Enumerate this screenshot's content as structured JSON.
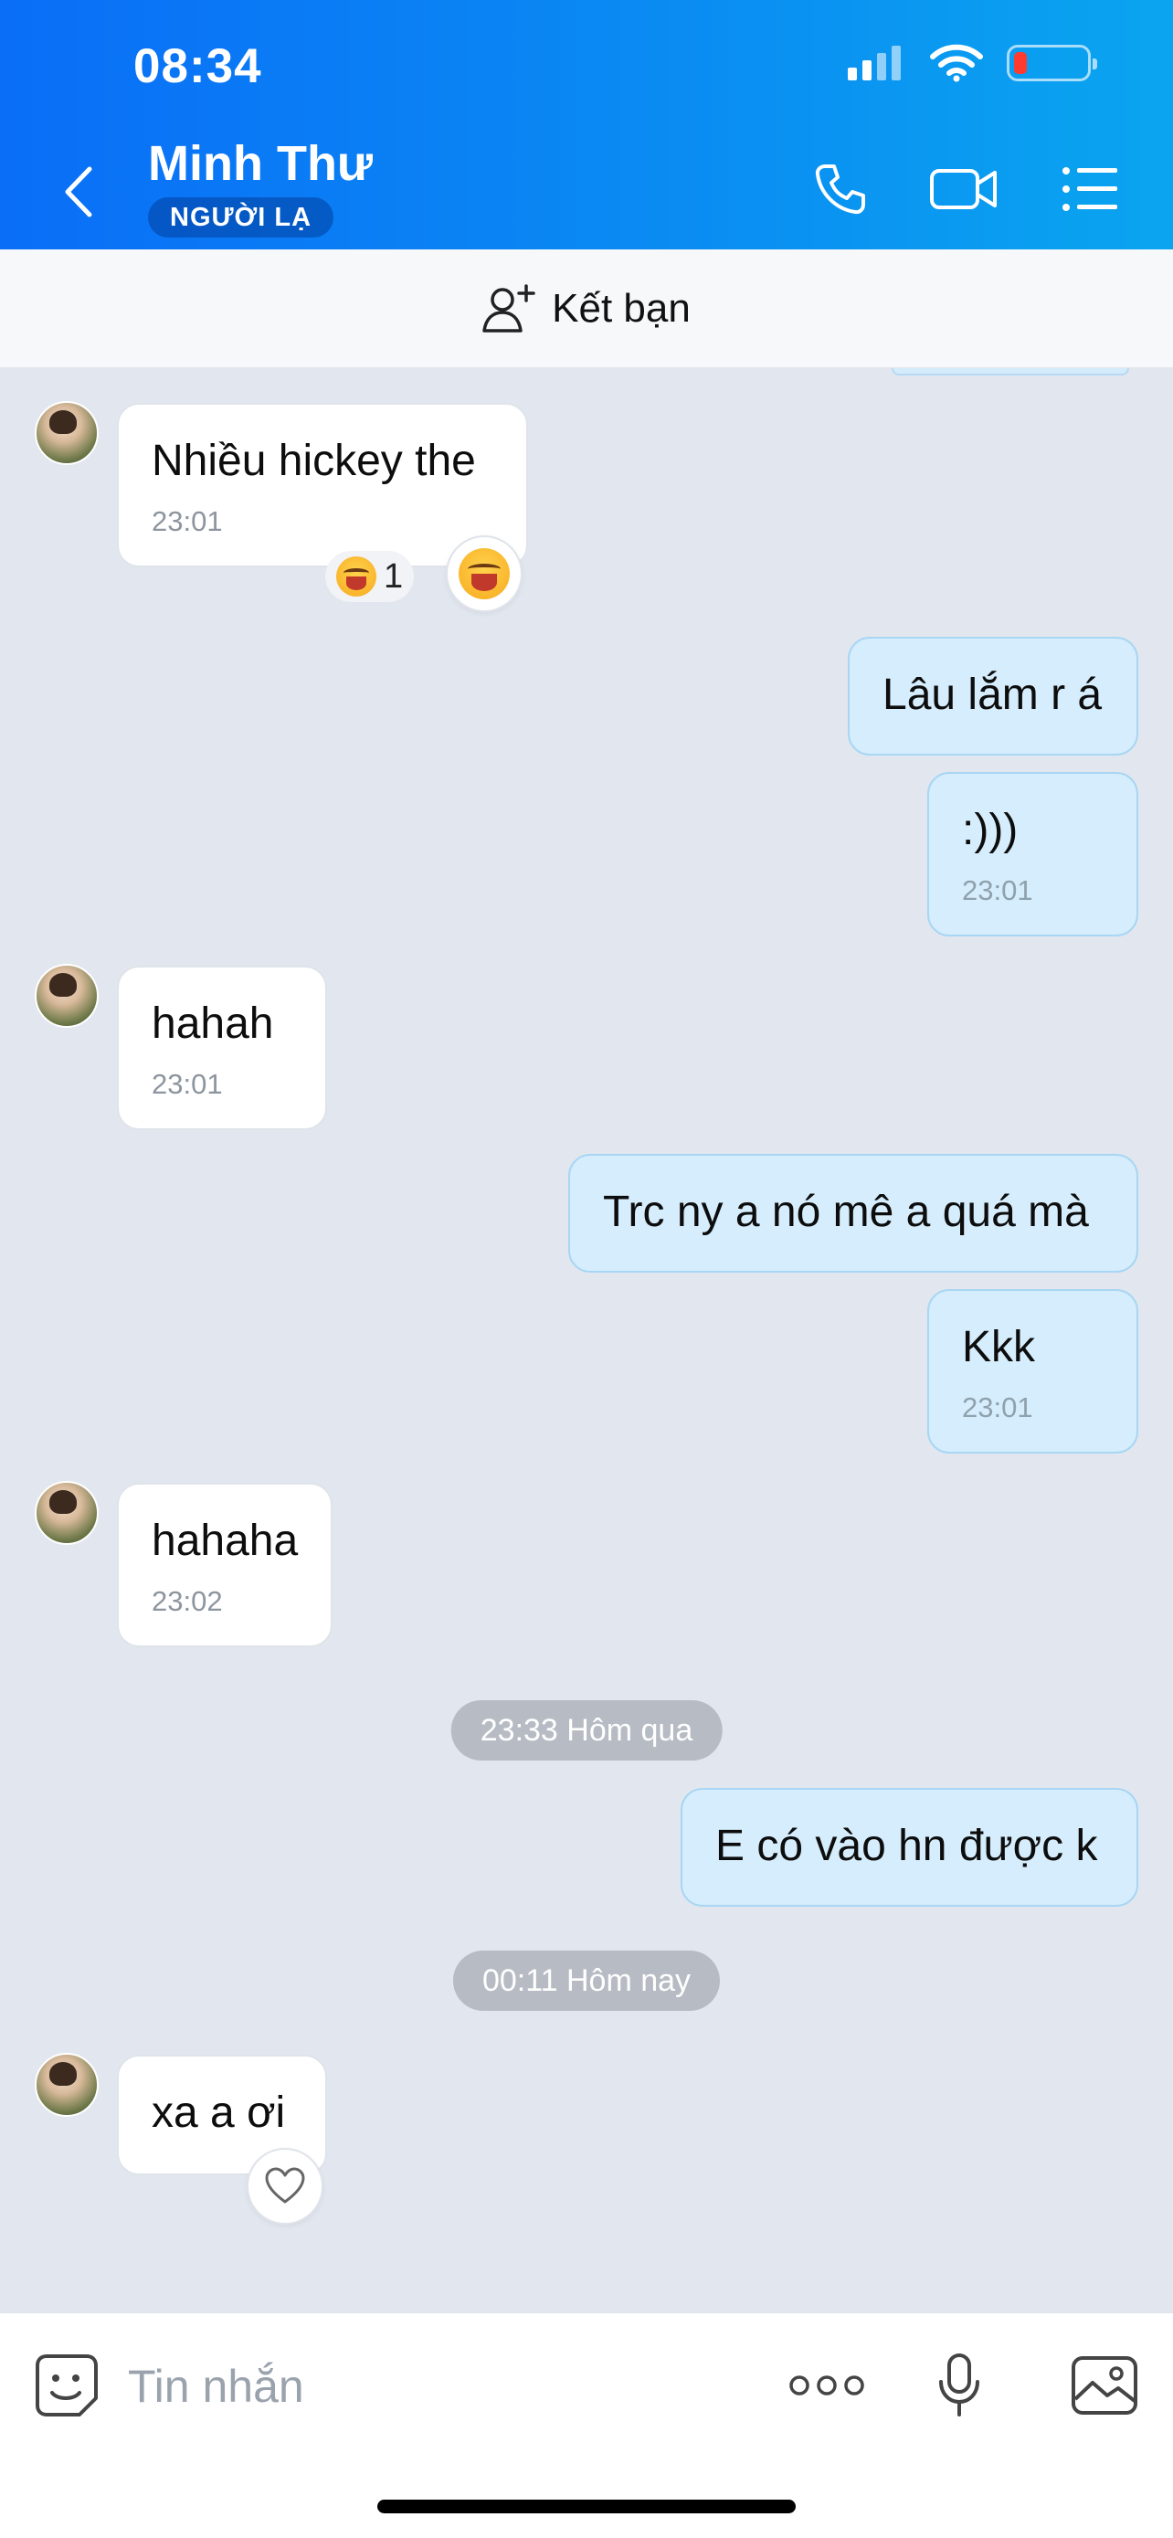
{
  "status": {
    "time": "08:34"
  },
  "header": {
    "contact_name": "Minh Thư",
    "badge": "NGƯỜI LẠ",
    "icons": [
      "back-icon",
      "phone-icon",
      "video-call-icon",
      "list-menu-icon"
    ]
  },
  "friend_bar": {
    "label": "Kết bạn",
    "icon": "add-friend-icon"
  },
  "messages": [
    {
      "side": "in",
      "text": "Nhiều hickey the",
      "time": "23:01",
      "reaction": {
        "emoji": "laughing-face",
        "count": "1"
      }
    },
    {
      "side": "out",
      "text": "Lâu lắm r á"
    },
    {
      "side": "out",
      "text": ":)))",
      "time": "23:01"
    },
    {
      "side": "in",
      "text": "hahah",
      "time": "23:01"
    },
    {
      "side": "out",
      "text": "Trc ny a nó mê a quá mà"
    },
    {
      "side": "out",
      "text": "Kkk",
      "time": "23:01"
    },
    {
      "side": "in",
      "text": "hahaha",
      "time": "23:02"
    },
    {
      "separator": "23:33 Hôm qua"
    },
    {
      "side": "out",
      "text": "E có vào hn được k"
    },
    {
      "separator": "00:11 Hôm nay"
    },
    {
      "side": "in",
      "text": "xa a ơi",
      "reaction_button": "heart-icon"
    }
  ],
  "composer": {
    "placeholder": "Tin nhắn",
    "icons": [
      "sticker-icon",
      "more-options-icon",
      "microphone-icon",
      "image-icon"
    ]
  },
  "colors": {
    "header_start": "#0a6ef7",
    "header_end": "#0aa5f0",
    "outgoing_bubble": "#d5edfc",
    "incoming_bubble": "#ffffff",
    "chat_background": "#e2e7ef"
  }
}
